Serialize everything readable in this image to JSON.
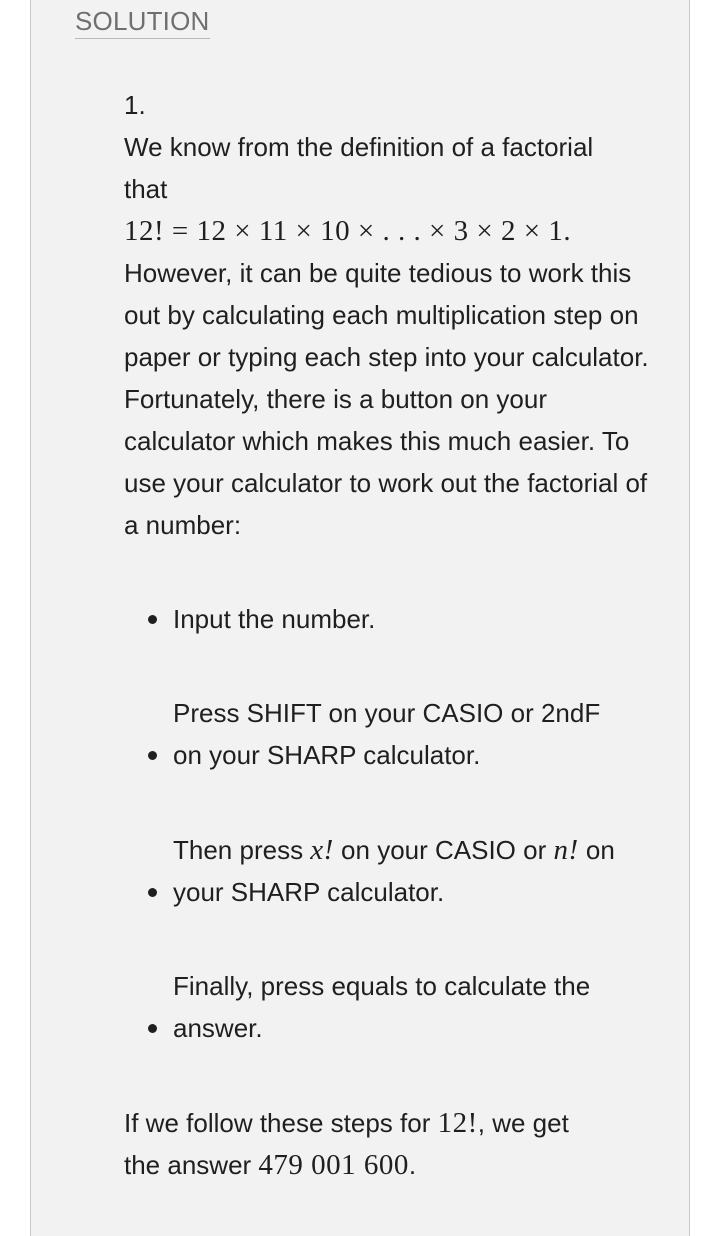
{
  "heading": "SOLUTION",
  "item_number": "1.",
  "intro": {
    "line1": "We know from the definition of a factorial",
    "line2": "that",
    "formula": "12! = 12 × 11 × 10 × . . . × 3 × 2 × 1.",
    "body": "However, it can be quite tedious to work this out by calculating each multiplication step on paper or typing each step into your calculator. Fortunately, there is a button on your calculator which makes this much easier. To use your calculator to work out the factorial of a number:"
  },
  "steps": [
    {
      "text": "Input the number."
    },
    {
      "line1": "Press SHIFT on your CASIO or 2ndF",
      "line2": "on your SHARP calculator."
    },
    {
      "pre": "Then press ",
      "math1": "x!",
      "mid": " on your CASIO or ",
      "math2": "n!",
      "post": " on",
      "line2": "your SHARP calculator."
    },
    {
      "line1": "Finally, press equals to calculate the",
      "line2": "answer."
    }
  ],
  "conclusion": {
    "pre": "If we follow these steps for ",
    "math1": "12!",
    "mid": ", we get",
    "line2_pre": "the answer ",
    "math2": "479 001 600",
    "post": "."
  }
}
